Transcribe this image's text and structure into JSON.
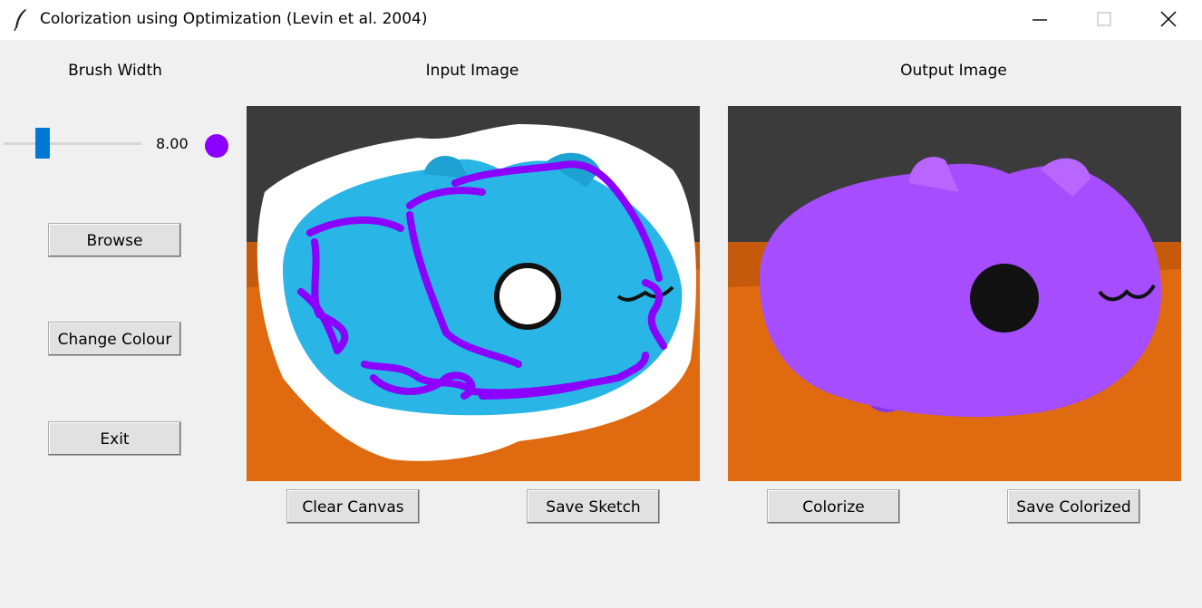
{
  "window": {
    "title": "Colorization using Optimization (Levin et al. 2004)"
  },
  "left_panel": {
    "brush_width_label": "Brush Width",
    "brush_width_value": "8.00",
    "slider_fraction": 0.26,
    "brush_color": "#8b00ff",
    "browse_label": "Browse",
    "change_colour_label": "Change Colour",
    "exit_label": "Exit"
  },
  "input_panel": {
    "title": "Input Image",
    "clear_label": "Clear Canvas",
    "save_label": "Save Sketch"
  },
  "output_panel": {
    "title": "Output Image",
    "colorize_label": "Colorize",
    "save_label": "Save Colorized"
  },
  "colors": {
    "scribble_blue": "#29b6e6",
    "output_purple": "#a64dff",
    "table_orange": "#e06a10",
    "background_gray": "#3b3b3b",
    "accent_blue": "#0078d7"
  }
}
